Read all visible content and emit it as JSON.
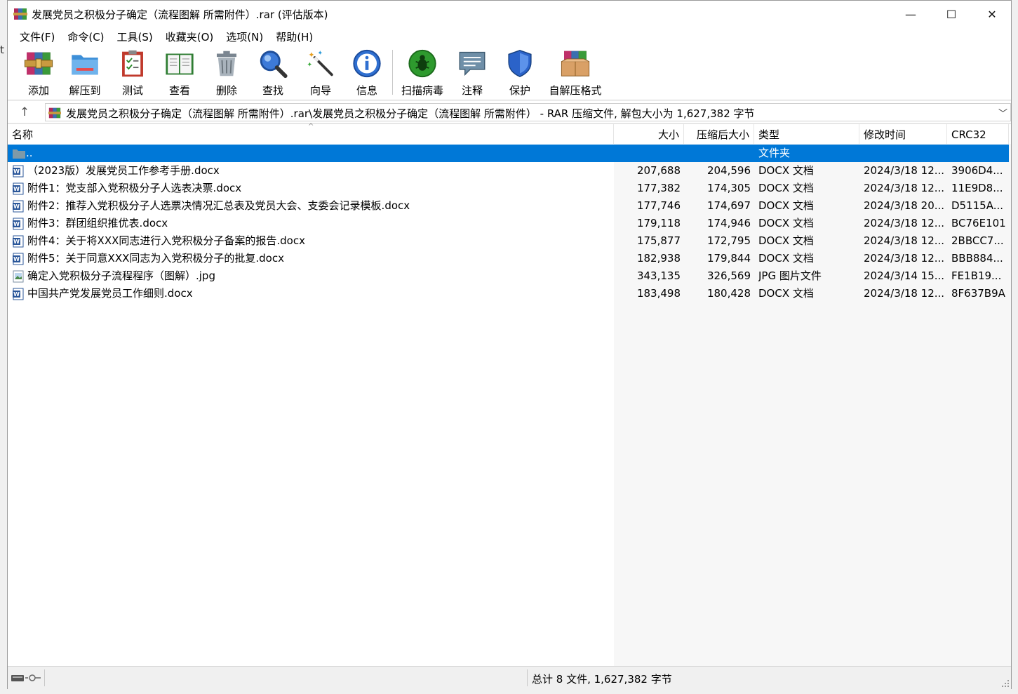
{
  "window": {
    "title": "发展党员之积极分子确定（流程图解 所需附件）.rar (评估版本)",
    "minimize_glyph": "—",
    "maximize_glyph": "☐",
    "close_glyph": "✕"
  },
  "menu": [
    "文件(F)",
    "命令(C)",
    "工具(S)",
    "收藏夹(O)",
    "选项(N)",
    "帮助(H)"
  ],
  "toolbar": [
    {
      "label": "添加",
      "icon": "add-archive-icon"
    },
    {
      "label": "解压到",
      "icon": "extract-folder-icon"
    },
    {
      "label": "测试",
      "icon": "test-clipboard-icon"
    },
    {
      "label": "查看",
      "icon": "view-book-icon"
    },
    {
      "label": "删除",
      "icon": "trash-icon"
    },
    {
      "label": "查找",
      "icon": "magnifier-icon"
    },
    {
      "label": "向导",
      "icon": "wizard-wand-icon"
    },
    {
      "label": "信息",
      "icon": "info-icon"
    },
    {
      "label": "扫描病毒",
      "icon": "virus-scan-icon"
    },
    {
      "label": "注释",
      "icon": "comment-icon"
    },
    {
      "label": "保护",
      "icon": "shield-icon"
    },
    {
      "label": "自解压格式",
      "icon": "sfx-box-icon"
    }
  ],
  "address": {
    "up_glyph": "↑",
    "path": "发展党员之积极分子确定（流程图解 所需附件）.rar\\发展党员之积极分子确定（流程图解 所需附件） - RAR 压缩文件, 解包大小为 1,627,382 字节",
    "dropdown_glyph": "﹀"
  },
  "columns": {
    "name": "名称",
    "size": "大小",
    "packed": "压缩后大小",
    "type": "类型",
    "modified": "修改时间",
    "crc": "CRC32"
  },
  "sort_glyph": "^",
  "parent_row": {
    "name": "..",
    "type": "文件夹"
  },
  "files": [
    {
      "name": "（2023版）发展党员工作参考手册.docx",
      "size": "207,688",
      "packed": "204,596",
      "type": "DOCX 文档",
      "modified": "2024/3/18 12...",
      "crc": "3906D4...",
      "kind": "docx"
    },
    {
      "name": "附件1：党支部入党积极分子人选表决票.docx",
      "size": "177,382",
      "packed": "174,305",
      "type": "DOCX 文档",
      "modified": "2024/3/18 12...",
      "crc": "11E9D8...",
      "kind": "docx"
    },
    {
      "name": "附件2：推荐入党积极分子人选票决情况汇总表及党员大会、支委会记录模板.docx",
      "size": "177,746",
      "packed": "174,697",
      "type": "DOCX 文档",
      "modified": "2024/3/18 20...",
      "crc": "D5115A...",
      "kind": "docx"
    },
    {
      "name": "附件3：群团组织推优表.docx",
      "size": "179,118",
      "packed": "174,946",
      "type": "DOCX 文档",
      "modified": "2024/3/18 12...",
      "crc": "BC76E101",
      "kind": "docx"
    },
    {
      "name": "附件4：关于将XXX同志进行入党积极分子备案的报告.docx",
      "size": "175,877",
      "packed": "172,795",
      "type": "DOCX 文档",
      "modified": "2024/3/18 12...",
      "crc": "2BBCC7...",
      "kind": "docx"
    },
    {
      "name": "附件5：关于同意XXX同志为入党积极分子的批复.docx",
      "size": "182,938",
      "packed": "179,844",
      "type": "DOCX 文档",
      "modified": "2024/3/18 12...",
      "crc": "BBB884...",
      "kind": "docx"
    },
    {
      "name": "确定入党积极分子流程程序（图解）.jpg",
      "size": "343,135",
      "packed": "326,569",
      "type": "JPG 图片文件",
      "modified": "2024/3/14 15...",
      "crc": "FE1B19...",
      "kind": "jpg"
    },
    {
      "name": "中国共产党发展党员工作细则.docx",
      "size": "183,498",
      "packed": "180,428",
      "type": "DOCX 文档",
      "modified": "2024/3/18 12...",
      "crc": "8F637B9A",
      "kind": "docx"
    }
  ],
  "status": {
    "summary": "总计 8 文件, 1,627,382 字节"
  },
  "colors": {
    "selection": "#0078d7",
    "docx_icon": "#2b579a",
    "folder": "#7f9aa8"
  }
}
